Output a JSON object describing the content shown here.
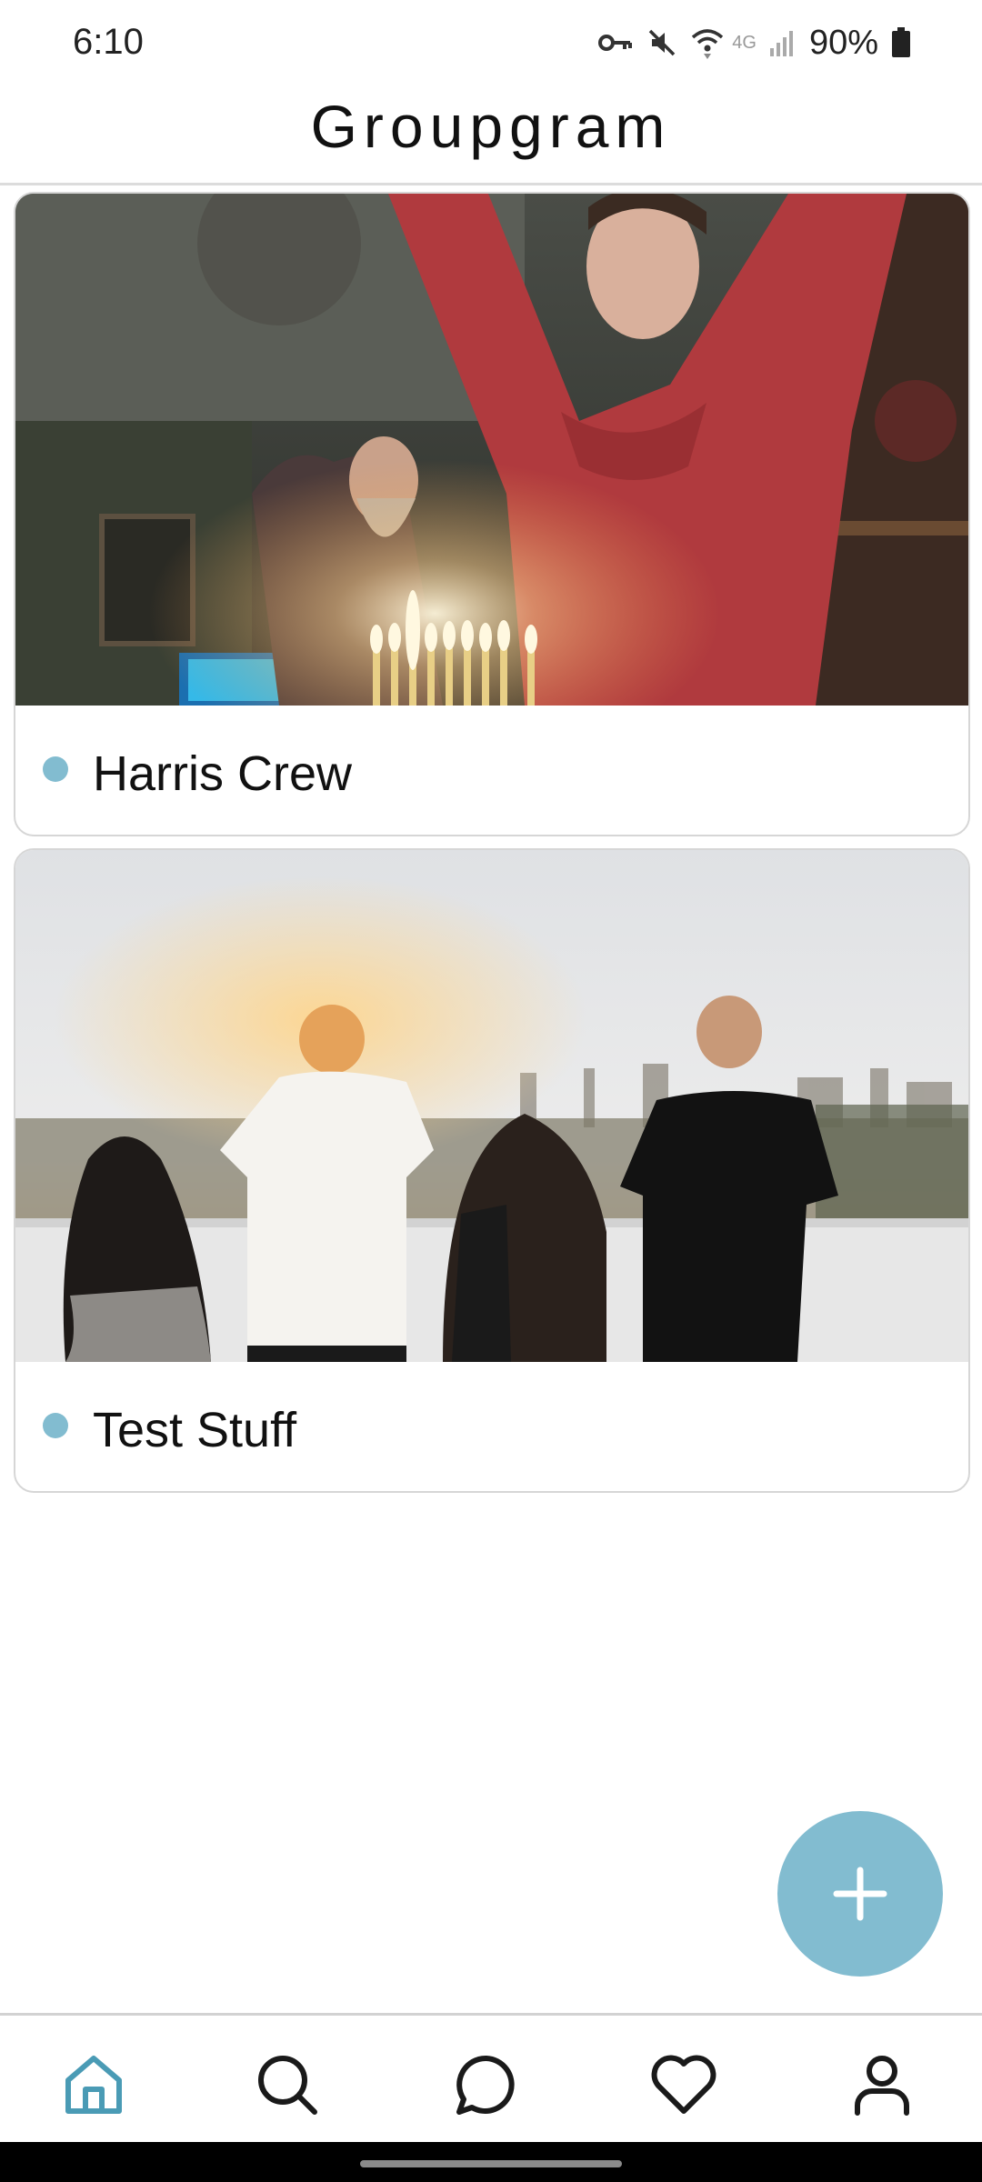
{
  "status_bar": {
    "time": "6:10",
    "network": "4G",
    "battery": "90%"
  },
  "app": {
    "title": "Groupgram"
  },
  "groups": [
    {
      "name": "Harris Crew"
    },
    {
      "name": "Test Stuff"
    }
  ],
  "colors": {
    "accent": "#82bcd0",
    "nav_active": "#4a9bb5",
    "icon": "#1a1a1a"
  },
  "icons": {
    "fab": "plus-icon",
    "nav": [
      "home-icon",
      "search-icon",
      "chat-icon",
      "heart-icon",
      "profile-icon"
    ]
  }
}
